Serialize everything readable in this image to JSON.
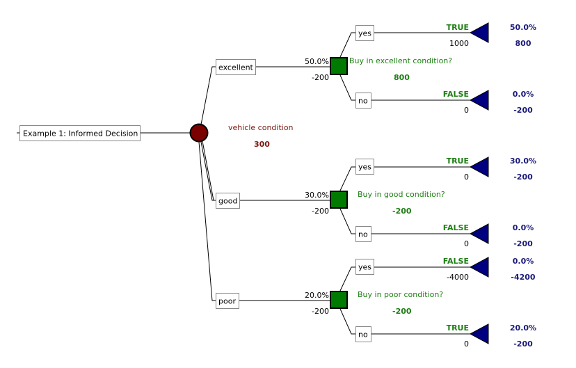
{
  "root": {
    "label": "Example 1:  Informed Decision"
  },
  "chance_node": {
    "name": "vehicle condition",
    "value": "300",
    "color": "#7b0000",
    "branches": [
      {
        "label": "excellent",
        "probability": "50.0%",
        "payoff": "-200",
        "decision": {
          "name": "Buy in excellent condition?",
          "value": "800",
          "color": "#007a00",
          "options": [
            {
              "label": "yes",
              "chosen": "TRUE",
              "payoff": "1000",
              "end_prob": "50.0%",
              "end_value": "800"
            },
            {
              "label": "no",
              "chosen": "FALSE",
              "payoff": "0",
              "end_prob": "0.0%",
              "end_value": "-200"
            }
          ]
        }
      },
      {
        "label": "good",
        "probability": "30.0%",
        "payoff": "-200",
        "decision": {
          "name": "Buy in good condition?",
          "value": "-200",
          "color": "#007a00",
          "options": [
            {
              "label": "yes",
              "chosen": "TRUE",
              "payoff": "0",
              "end_prob": "30.0%",
              "end_value": "-200"
            },
            {
              "label": "no",
              "chosen": "FALSE",
              "payoff": "0",
              "end_prob": "0.0%",
              "end_value": "-200"
            }
          ]
        }
      },
      {
        "label": "poor",
        "probability": "20.0%",
        "payoff": "-200",
        "decision": {
          "name": "Buy in poor condition?",
          "value": "-200",
          "color": "#007a00",
          "options": [
            {
              "label": "yes",
              "chosen": "FALSE",
              "payoff": "-4000",
              "end_prob": "0.0%",
              "end_value": "-4200"
            },
            {
              "label": "no",
              "chosen": "TRUE",
              "payoff": "0",
              "end_prob": "20.0%",
              "end_value": "-200"
            }
          ]
        }
      }
    ]
  },
  "colors": {
    "chance_fill": "#7b0000",
    "decision_fill": "#007a00",
    "terminal_fill": "#000080",
    "decision_text": "#1e7f14",
    "chance_text": "#7b1a12",
    "terminal_text": "#1a1a7a"
  }
}
